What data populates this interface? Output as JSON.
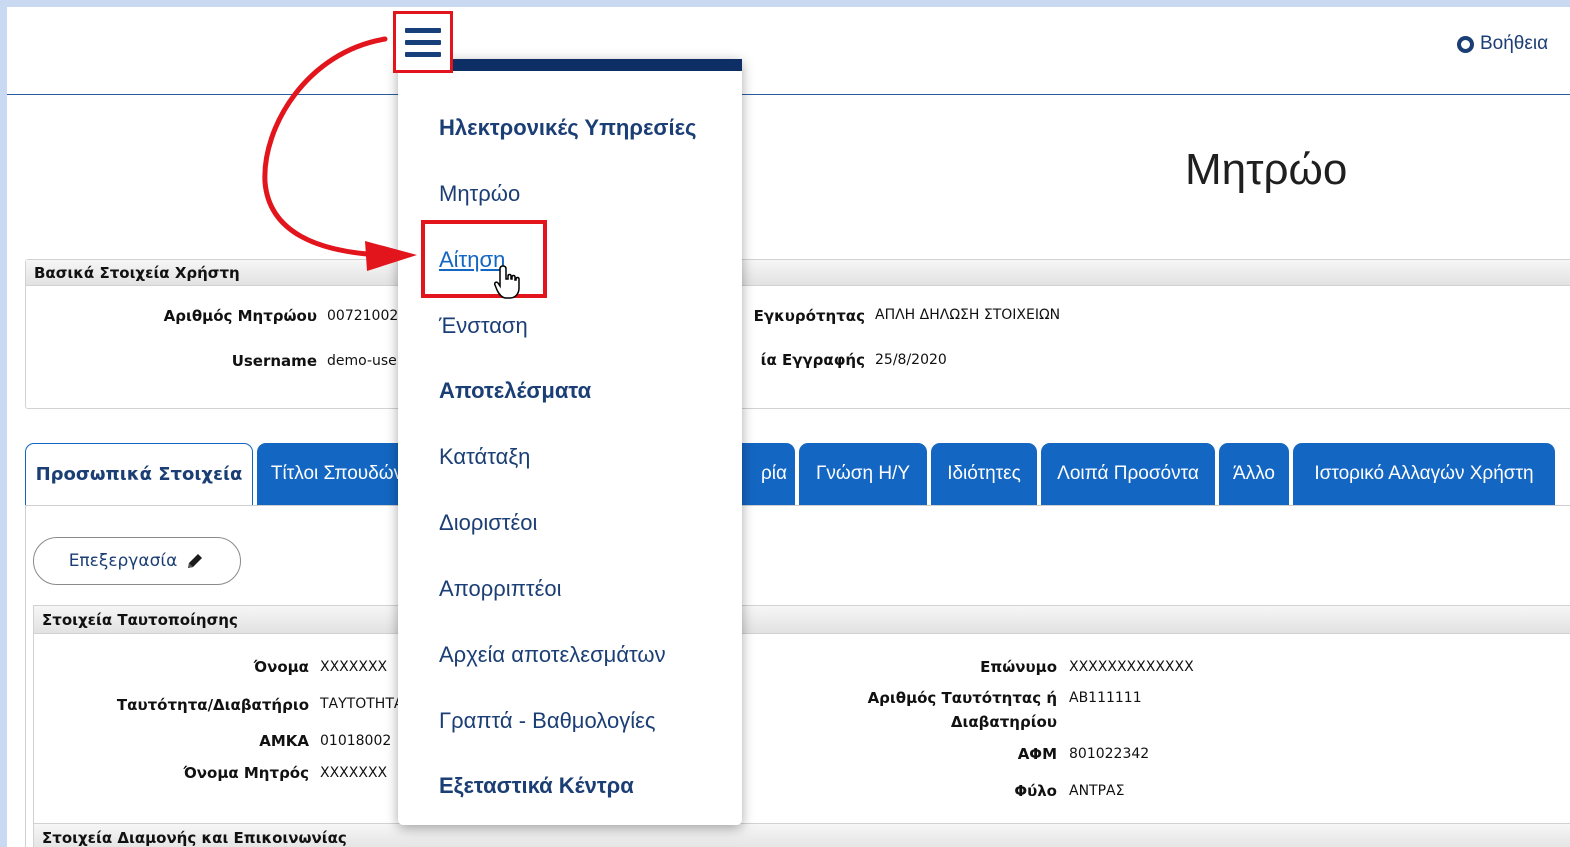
{
  "header": {
    "help_label": "Βοήθεια",
    "page_title": "Μητρώο"
  },
  "basic_info": {
    "title": "Βασικά Στοιχεία Χρήστη",
    "registry_number_label": "Αριθμός Μητρώου",
    "registry_number_value": "00721002",
    "username_label": "Username",
    "username_value": "demo-user",
    "validity_label": "Εγκυρότητας",
    "validity_value": "ΑΠΛΗ ΔΗΛΩΣΗ ΣΤΟΙΧΕΙΩΝ",
    "registration_date_label": "ία Εγγραφής",
    "registration_date_value": "25/8/2020"
  },
  "tabs": [
    {
      "label": "Προσωπικά Στοιχεία",
      "active": true
    },
    {
      "label": "Τίτλοι Σπουδών"
    },
    {
      "label": "ρία"
    },
    {
      "label": "Γνώση Η/Υ"
    },
    {
      "label": "Ιδιότητες"
    },
    {
      "label": "Λοιπά Προσόντα"
    },
    {
      "label": "Άλλο"
    },
    {
      "label": "Ιστορικό Αλλαγών Χρήστη"
    }
  ],
  "edit_button": {
    "label": "Επεξεργασία"
  },
  "identification": {
    "title": "Στοιχεία Ταυτοποίησης",
    "first_name_label": "Όνομα",
    "first_name_value": "XXXXXXX",
    "id_type_label": "Ταυτότητα/Διαβατήριο",
    "id_type_value": "ΤΑΥΤΟΤΗΤΑ",
    "amka_label": "ΑΜΚΑ",
    "amka_value": "01018002",
    "mother_name_label": "Όνομα Μητρός",
    "mother_name_value": "XXXXXXX",
    "surname_label": "Επώνυμο",
    "surname_value": "XXXXXXXXXXXXX",
    "id_number_label_1": "Αριθμός Ταυτότητας ή",
    "id_number_label_2": "Διαβατηρίου",
    "id_number_value": "AB111111",
    "afm_label": "ΑΦΜ",
    "afm_value": "801022342",
    "gender_label": "Φύλο",
    "gender_value": "ΑΝΤΡΑΣ"
  },
  "residence": {
    "title": "Στοιχεία Διαμονής και Επικοινωνίας"
  },
  "menu": {
    "items": [
      {
        "label": "Ηλεκτρονικές Υπηρεσίες",
        "kind": "head"
      },
      {
        "label": "Μητρώο",
        "kind": "item"
      },
      {
        "label": "Αίτηση",
        "kind": "link"
      },
      {
        "label": "Ένσταση",
        "kind": "item"
      },
      {
        "label": "Αποτελέσματα",
        "kind": "head"
      },
      {
        "label": "Κατάταξη",
        "kind": "item"
      },
      {
        "label": "Διοριστέοι",
        "kind": "item"
      },
      {
        "label": "Απορριπτέοι",
        "kind": "item"
      },
      {
        "label": "Αρχεία αποτελεσμάτων",
        "kind": "item"
      },
      {
        "label": "Γραπτά - Βαθμολογίες",
        "kind": "item"
      },
      {
        "label": "Εξεταστικά Κέντρα",
        "kind": "head"
      }
    ]
  },
  "colors": {
    "accent": "#1366c2",
    "navy": "#0d2f66",
    "highlight": "#e2141c",
    "outer_background": "#c9d9f1"
  }
}
